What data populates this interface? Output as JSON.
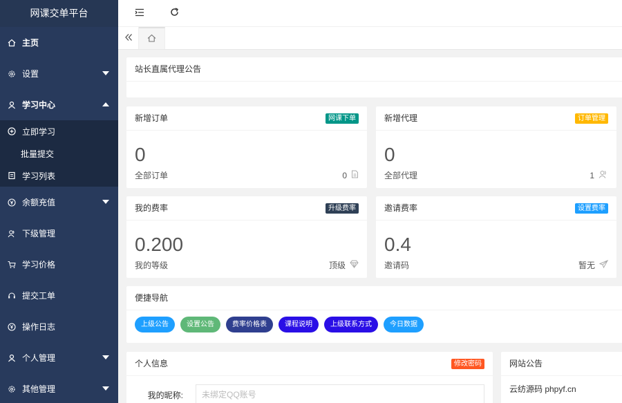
{
  "sidebar": {
    "brand": "网课交单平台",
    "items": [
      {
        "label": "主页",
        "icon": "home-icon",
        "bold": true
      },
      {
        "label": "设置",
        "icon": "gear-icon",
        "arrow": "down"
      },
      {
        "label": "学习中心",
        "icon": "user-icon",
        "arrow": "up",
        "bold": true
      },
      {
        "label": "余额充值",
        "icon": "yen-icon",
        "arrow": "down"
      },
      {
        "label": "下级管理",
        "icon": "users-icon"
      },
      {
        "label": "学习价格",
        "icon": "cart-icon"
      },
      {
        "label": "提交工单",
        "icon": "headset-icon"
      },
      {
        "label": "操作日志",
        "icon": "yen-icon"
      },
      {
        "label": "个人管理",
        "icon": "user-icon",
        "arrow": "down"
      },
      {
        "label": "其他管理",
        "icon": "gear-icon",
        "arrow": "down"
      }
    ],
    "submenu": [
      {
        "label": "立即学习",
        "icon": "plus-circle-icon"
      },
      {
        "label": "批量提交",
        "icon": ""
      },
      {
        "label": "学习列表",
        "icon": "list-icon"
      }
    ]
  },
  "announce": {
    "title": "站长直属代理公告"
  },
  "cards": {
    "orders": {
      "title": "新增订单",
      "badge": "网课下单",
      "badge_color": "#009688",
      "value": "0",
      "foot_label": "全部订单",
      "foot_value": "0"
    },
    "agents": {
      "title": "新增代理",
      "badge": "订单管理",
      "badge_color": "#ffb800",
      "value": "0",
      "foot_label": "全部代理",
      "foot_value": "1"
    },
    "rate": {
      "title": "我的费率",
      "badge": "升级费率",
      "badge_color": "#2f4056",
      "value": "0.200",
      "foot_label": "我的等级",
      "foot_value": "顶级"
    },
    "invite": {
      "title": "邀请费率",
      "badge": "设置费率",
      "badge_color": "#1e9fff",
      "value": "0.4",
      "foot_label": "邀请码",
      "foot_value": "暂无"
    }
  },
  "quicknav": {
    "title": "便捷导航",
    "buttons": [
      {
        "label": "上级公告",
        "color": "#1e9fff"
      },
      {
        "label": "设置公告",
        "color": "#5fb878"
      },
      {
        "label": "费率价格表",
        "color": "#2f3f8f"
      },
      {
        "label": "课程说明",
        "color": "#2a0fe6"
      },
      {
        "label": "上级联系方式",
        "color": "#2a0fe6"
      },
      {
        "label": "今日数据",
        "color": "#1e9fff"
      }
    ]
  },
  "profile": {
    "title": "个人信息",
    "badge": "修改密码",
    "badge_color": "#ff5722",
    "nickname_label": "我的昵称:",
    "nickname_placeholder": "未绑定QQ账号"
  },
  "site_notice": {
    "title": "网站公告",
    "text": "云纺源码 phpyf.cn"
  }
}
